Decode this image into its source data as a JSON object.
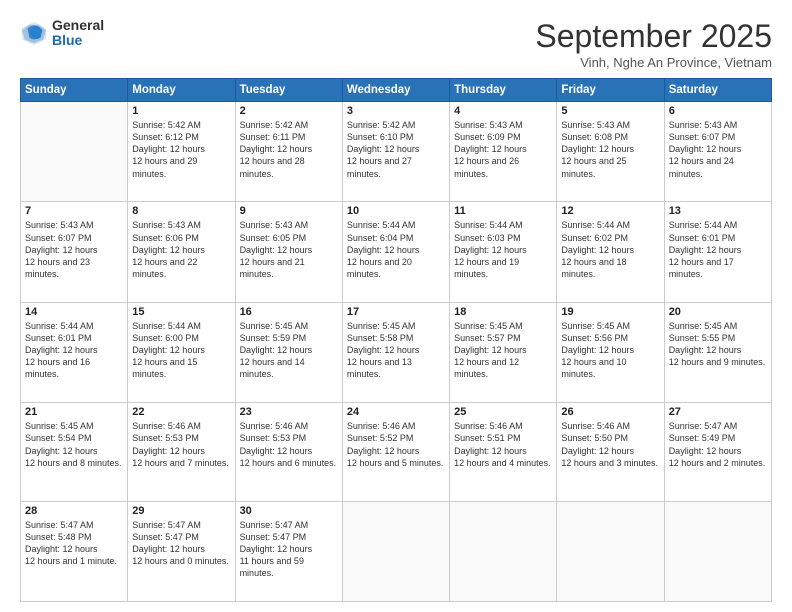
{
  "logo": {
    "general": "General",
    "blue": "Blue"
  },
  "header": {
    "month": "September 2025",
    "location": "Vinh, Nghe An Province, Vietnam"
  },
  "days": [
    "Sunday",
    "Monday",
    "Tuesday",
    "Wednesday",
    "Thursday",
    "Friday",
    "Saturday"
  ],
  "weeks": [
    [
      {
        "day": "",
        "empty": true
      },
      {
        "day": "1",
        "sunrise": "5:42 AM",
        "sunset": "6:12 PM",
        "daylight": "12 hours and 29 minutes."
      },
      {
        "day": "2",
        "sunrise": "5:42 AM",
        "sunset": "6:11 PM",
        "daylight": "12 hours and 28 minutes."
      },
      {
        "day": "3",
        "sunrise": "5:42 AM",
        "sunset": "6:10 PM",
        "daylight": "12 hours and 27 minutes."
      },
      {
        "day": "4",
        "sunrise": "5:43 AM",
        "sunset": "6:09 PM",
        "daylight": "12 hours and 26 minutes."
      },
      {
        "day": "5",
        "sunrise": "5:43 AM",
        "sunset": "6:08 PM",
        "daylight": "12 hours and 25 minutes."
      },
      {
        "day": "6",
        "sunrise": "5:43 AM",
        "sunset": "6:07 PM",
        "daylight": "12 hours and 24 minutes."
      }
    ],
    [
      {
        "day": "7",
        "sunrise": "5:43 AM",
        "sunset": "6:07 PM",
        "daylight": "12 hours and 23 minutes."
      },
      {
        "day": "8",
        "sunrise": "5:43 AM",
        "sunset": "6:06 PM",
        "daylight": "12 hours and 22 minutes."
      },
      {
        "day": "9",
        "sunrise": "5:43 AM",
        "sunset": "6:05 PM",
        "daylight": "12 hours and 21 minutes."
      },
      {
        "day": "10",
        "sunrise": "5:44 AM",
        "sunset": "6:04 PM",
        "daylight": "12 hours and 20 minutes."
      },
      {
        "day": "11",
        "sunrise": "5:44 AM",
        "sunset": "6:03 PM",
        "daylight": "12 hours and 19 minutes."
      },
      {
        "day": "12",
        "sunrise": "5:44 AM",
        "sunset": "6:02 PM",
        "daylight": "12 hours and 18 minutes."
      },
      {
        "day": "13",
        "sunrise": "5:44 AM",
        "sunset": "6:01 PM",
        "daylight": "12 hours and 17 minutes."
      }
    ],
    [
      {
        "day": "14",
        "sunrise": "5:44 AM",
        "sunset": "6:01 PM",
        "daylight": "12 hours and 16 minutes."
      },
      {
        "day": "15",
        "sunrise": "5:44 AM",
        "sunset": "6:00 PM",
        "daylight": "12 hours and 15 minutes."
      },
      {
        "day": "16",
        "sunrise": "5:45 AM",
        "sunset": "5:59 PM",
        "daylight": "12 hours and 14 minutes."
      },
      {
        "day": "17",
        "sunrise": "5:45 AM",
        "sunset": "5:58 PM",
        "daylight": "12 hours and 13 minutes."
      },
      {
        "day": "18",
        "sunrise": "5:45 AM",
        "sunset": "5:57 PM",
        "daylight": "12 hours and 12 minutes."
      },
      {
        "day": "19",
        "sunrise": "5:45 AM",
        "sunset": "5:56 PM",
        "daylight": "12 hours and 10 minutes."
      },
      {
        "day": "20",
        "sunrise": "5:45 AM",
        "sunset": "5:55 PM",
        "daylight": "12 hours and 9 minutes."
      }
    ],
    [
      {
        "day": "21",
        "sunrise": "5:45 AM",
        "sunset": "5:54 PM",
        "daylight": "12 hours and 8 minutes."
      },
      {
        "day": "22",
        "sunrise": "5:46 AM",
        "sunset": "5:53 PM",
        "daylight": "12 hours and 7 minutes."
      },
      {
        "day": "23",
        "sunrise": "5:46 AM",
        "sunset": "5:53 PM",
        "daylight": "12 hours and 6 minutes."
      },
      {
        "day": "24",
        "sunrise": "5:46 AM",
        "sunset": "5:52 PM",
        "daylight": "12 hours and 5 minutes."
      },
      {
        "day": "25",
        "sunrise": "5:46 AM",
        "sunset": "5:51 PM",
        "daylight": "12 hours and 4 minutes."
      },
      {
        "day": "26",
        "sunrise": "5:46 AM",
        "sunset": "5:50 PM",
        "daylight": "12 hours and 3 minutes."
      },
      {
        "day": "27",
        "sunrise": "5:47 AM",
        "sunset": "5:49 PM",
        "daylight": "12 hours and 2 minutes."
      }
    ],
    [
      {
        "day": "28",
        "sunrise": "5:47 AM",
        "sunset": "5:48 PM",
        "daylight": "12 hours and 1 minute."
      },
      {
        "day": "29",
        "sunrise": "5:47 AM",
        "sunset": "5:47 PM",
        "daylight": "12 hours and 0 minutes."
      },
      {
        "day": "30",
        "sunrise": "5:47 AM",
        "sunset": "5:47 PM",
        "daylight": "11 hours and 59 minutes."
      },
      {
        "day": "",
        "empty": true
      },
      {
        "day": "",
        "empty": true
      },
      {
        "day": "",
        "empty": true
      },
      {
        "day": "",
        "empty": true
      }
    ]
  ]
}
